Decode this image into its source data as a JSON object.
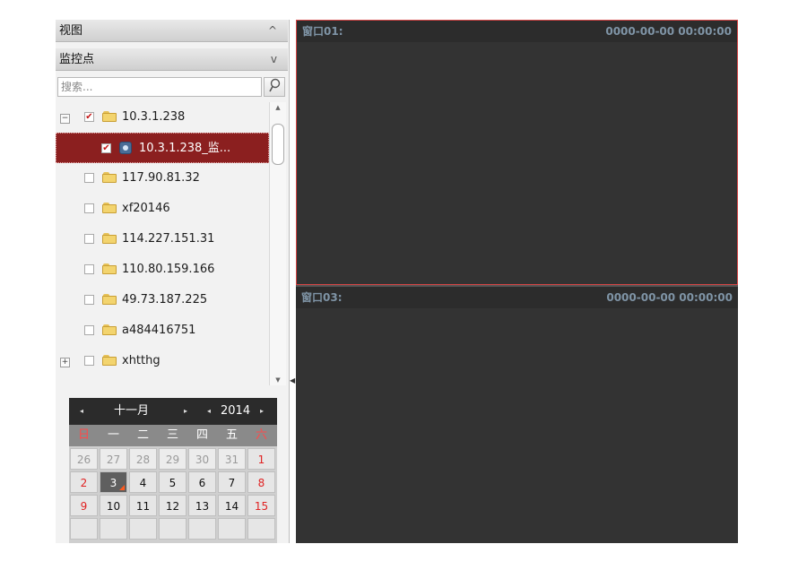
{
  "panel": {
    "view_header": "视图",
    "view_chevron": "^",
    "monitor_header": "监控点",
    "monitor_chevron": "v",
    "search_placeholder": "搜索...",
    "search_icon": "⚲"
  },
  "tree": [
    {
      "label": "10.3.1.238",
      "expander": "−",
      "checked": true,
      "type": "folder"
    },
    {
      "label": "10.3.1.238_监...",
      "checked": true,
      "type": "camera",
      "selected": true
    },
    {
      "label": "117.90.81.32",
      "checked": false,
      "type": "folder"
    },
    {
      "label": "xf20146",
      "checked": false,
      "type": "folder"
    },
    {
      "label": "114.227.151.31",
      "checked": false,
      "type": "folder"
    },
    {
      "label": "110.80.159.166",
      "checked": false,
      "type": "folder"
    },
    {
      "label": "49.73.187.225",
      "checked": false,
      "type": "folder"
    },
    {
      "label": "a484416751",
      "checked": false,
      "type": "folder"
    },
    {
      "label": "xhtthg",
      "expander": "+",
      "checked": false,
      "type": "folder"
    }
  ],
  "calendar": {
    "prev_month": "◂",
    "month": "十一月",
    "next_month": "▸",
    "prev_year": "◂",
    "year": "2014",
    "next_year": "▸",
    "weekdays": [
      "日",
      "一",
      "二",
      "三",
      "四",
      "五",
      "六"
    ],
    "weeks": [
      [
        "26",
        "27",
        "28",
        "29",
        "30",
        "31",
        "1"
      ],
      [
        "2",
        "3",
        "4",
        "5",
        "6",
        "7",
        "8"
      ],
      [
        "9",
        "10",
        "11",
        "12",
        "13",
        "14",
        "15"
      ]
    ],
    "today": "3"
  },
  "windows": [
    {
      "title": "窗口01:",
      "timestamp": "0000-00-00 00:00:00"
    },
    {
      "title": "窗口03:",
      "timestamp": "0000-00-00 00:00:00"
    }
  ],
  "colors": {
    "selection": "#8b1f1f",
    "window_bg": "#333333",
    "window_active_border": "#d64545",
    "weekend_red": "#e02222"
  }
}
